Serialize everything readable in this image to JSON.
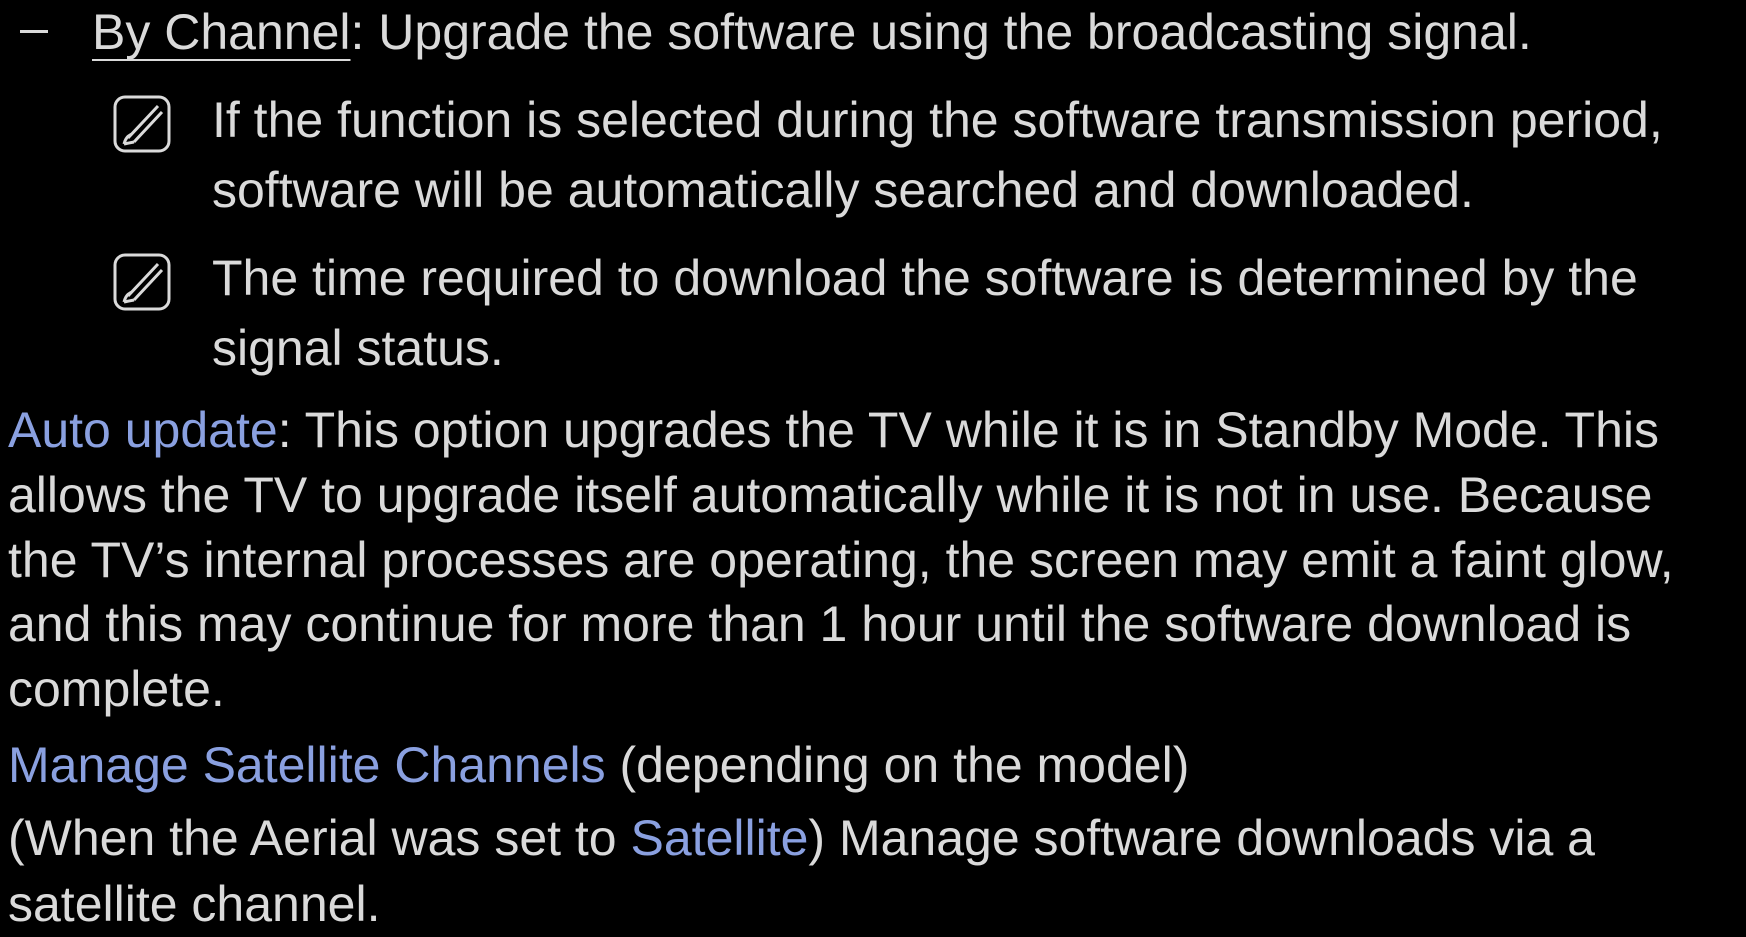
{
  "by_channel": {
    "link_text": "By Channel",
    "rest_text": ": Upgrade the software using the broadcasting signal."
  },
  "notes": [
    {
      "icon": "note-icon",
      "line1": "If the function is selected during the software transmission period,",
      "line2": "software will be automatically searched and downloaded."
    },
    {
      "icon": "note-icon",
      "line1": "The time required to download the software is determined by the",
      "line2": "signal status."
    }
  ],
  "auto_update": {
    "title": "Auto update",
    "line1_rest": ": This option upgrades the TV while it is in Standby Mode. This",
    "line2": "allows the TV to upgrade itself automatically while it is not in use. Because",
    "line3": "the TV’s internal processes are operating, the screen may emit a faint glow,",
    "line4": "and this may continue for more than 1 hour until the software download is",
    "line5": "complete."
  },
  "manage_satellite": {
    "title": "Manage Satellite Channels",
    "qualifier": " (depending on the model)",
    "desc_prefix": "(When the Aerial was set to ",
    "desc_highlight": "Satellite",
    "desc_suffix": ") Manage software downloads via a",
    "desc_line2": "satellite channel."
  },
  "colors": {
    "background": "#000000",
    "text": "#dadada",
    "highlight": "#8aa0e0"
  }
}
